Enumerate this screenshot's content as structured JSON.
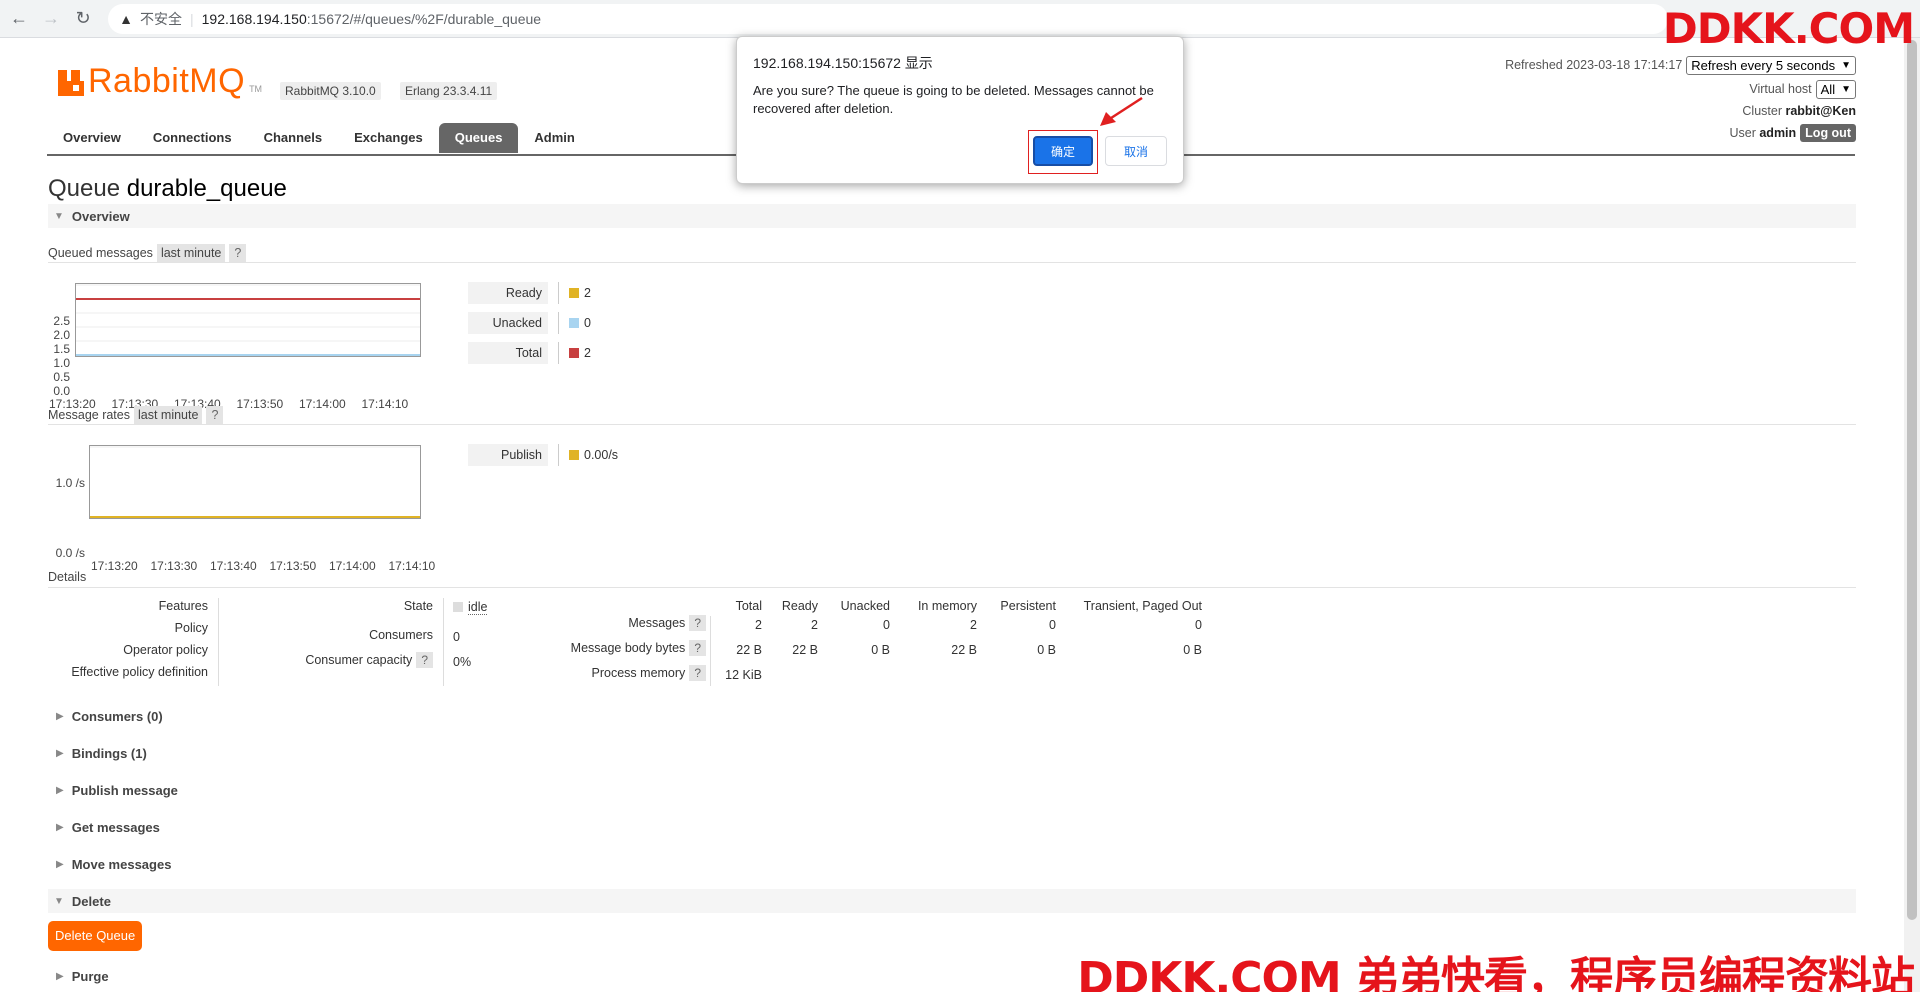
{
  "browser": {
    "insecure_label": "不安全",
    "url_host": "192.168.194.150",
    "url_rest": ":15672/#/queues/%2F/durable_queue"
  },
  "watermark": {
    "top": "DDKK.COM",
    "bottom": "DDKK.COM 弟弟快看，程序员编程资料站"
  },
  "header": {
    "logo_rabbit": "Rabbit",
    "logo_mq": "MQ",
    "logo_tm": "TM",
    "rabbit_version": "RabbitMQ 3.10.0",
    "erlang_version": "Erlang 23.3.4.11"
  },
  "nav": {
    "tabs": [
      "Overview",
      "Connections",
      "Channels",
      "Exchanges",
      "Queues",
      "Admin"
    ],
    "active": "Queues"
  },
  "status": {
    "refreshed_label": "Refreshed 2023-03-18 17:14:17",
    "refresh_select": "Refresh every 5 seconds",
    "vhost_label": "Virtual host",
    "vhost_select": "All",
    "cluster_label": "Cluster",
    "cluster_name": "rabbit@Ken",
    "user_label": "User",
    "user_name": "admin",
    "logout_label": "Log out"
  },
  "queue": {
    "title_prefix": "Queue",
    "name": "durable_queue"
  },
  "overview": {
    "section_label": "Overview",
    "queued_messages_label": "Queued messages",
    "period_label": "last minute",
    "help_label": "?",
    "message_rates_label": "Message rates"
  },
  "chart_data": [
    {
      "type": "line",
      "x": [
        "17:13:20",
        "17:13:30",
        "17:13:40",
        "17:13:50",
        "17:14:00",
        "17:14:10"
      ],
      "yticks": [
        "2.5",
        "2.0",
        "1.5",
        "1.0",
        "0.5",
        "0.0"
      ],
      "ylim": [
        0,
        2.5
      ],
      "series": [
        {
          "name": "Ready",
          "color": "#e0b325",
          "values": [
            2,
            2,
            2,
            2,
            2,
            2
          ]
        },
        {
          "name": "Unacked",
          "color": "#a8d4f0",
          "values": [
            0,
            0,
            0,
            0,
            0,
            0
          ]
        },
        {
          "name": "Total",
          "color": "#c84040",
          "values": [
            2,
            2,
            2,
            2,
            2,
            2
          ]
        }
      ],
      "legend_values": [
        "2",
        "0",
        "2"
      ]
    },
    {
      "type": "line",
      "x": [
        "17:13:20",
        "17:13:30",
        "17:13:40",
        "17:13:50",
        "17:14:00",
        "17:14:10"
      ],
      "yticks": [
        "1.0 /s",
        "0.0 /s"
      ],
      "ylim": [
        0,
        1
      ],
      "series": [
        {
          "name": "Publish",
          "color": "#e0b325",
          "values": [
            0,
            0,
            0,
            0,
            0,
            0
          ]
        }
      ],
      "legend_values": [
        "0.00/s"
      ]
    }
  ],
  "details": {
    "title": "Details",
    "left_labels": [
      "Features",
      "Policy",
      "Operator policy",
      "Effective policy definition"
    ],
    "state_label": "State",
    "state_value": "idle",
    "consumers_label": "Consumers",
    "consumers_value": "0",
    "capacity_label": "Consumer capacity",
    "capacity_value": "0%",
    "table_headers": [
      "Total",
      "Ready",
      "Unacked",
      "In memory",
      "Persistent",
      "Transient, Paged Out"
    ],
    "rows": [
      {
        "label": "Messages",
        "values": [
          "2",
          "2",
          "0",
          "2",
          "0",
          "0"
        ]
      },
      {
        "label": "Message body bytes",
        "values": [
          "22 B",
          "22 B",
          "0 B",
          "22 B",
          "0 B",
          "0 B"
        ]
      },
      {
        "label": "Process memory",
        "values": [
          "12 KiB"
        ]
      }
    ]
  },
  "sections": {
    "consumers": "Consumers (0)",
    "bindings": "Bindings (1)",
    "publish": "Publish message",
    "get": "Get messages",
    "move": "Move messages",
    "delete": "Delete",
    "delete_button": "Delete Queue",
    "purge": "Purge"
  },
  "dialog": {
    "title": "192.168.194.150:15672 显示",
    "message": "Are you sure? The queue is going to be deleted. Messages cannot be recovered after deletion.",
    "ok_label": "确定",
    "cancel_label": "取消"
  }
}
